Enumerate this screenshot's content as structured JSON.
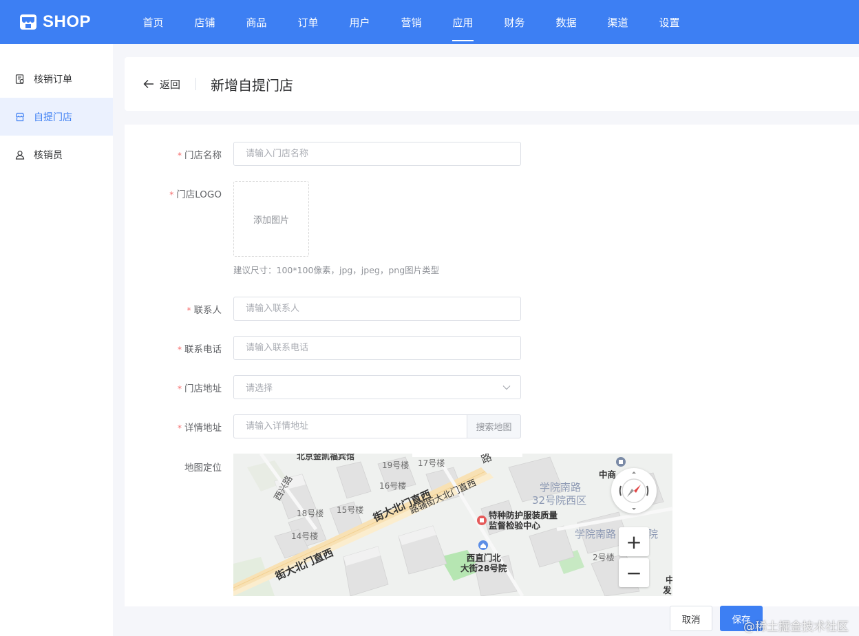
{
  "brand": {
    "name": "SHOP",
    "icon": "shop-icon"
  },
  "nav": {
    "items": [
      "首页",
      "店铺",
      "商品",
      "订单",
      "用户",
      "营销",
      "应用",
      "财务",
      "数据",
      "渠道",
      "设置"
    ],
    "active": "应用"
  },
  "sidebar": {
    "items": [
      {
        "label": "核销订单",
        "icon": "order-doc-icon"
      },
      {
        "label": "自提门店",
        "icon": "store-icon",
        "active": true
      },
      {
        "label": "核销员",
        "icon": "user-icon"
      }
    ]
  },
  "header": {
    "back_label": "返回",
    "title": "新增自提门店"
  },
  "form": {
    "store_name": {
      "label": "门店名称",
      "placeholder": "请输入门店名称"
    },
    "logo": {
      "label": "门店LOGO",
      "upload_label": "添加图片",
      "hint": "建议尺寸：100*100像素，jpg，jpeg，png图片类型"
    },
    "contact": {
      "label": "联系人",
      "placeholder": "请输入联系人"
    },
    "phone": {
      "label": "联系电话",
      "placeholder": "请输入联系电话"
    },
    "address": {
      "label": "门店地址",
      "placeholder": "请选择"
    },
    "detail_address": {
      "label": "详情地址",
      "placeholder": "请输入详情地址",
      "search_label": "搜索地图"
    },
    "map": {
      "label": "地图定位"
    }
  },
  "map_labels": {
    "hotel": "北京金凯福宾馆",
    "b19": "19号楼",
    "b17": "17号楼",
    "b16": "16号楼",
    "b18": "18号楼",
    "b15": "15号楼",
    "b14": "14号楼",
    "b2": "2号楼",
    "road_lu": "路",
    "road_xingxi": "西兴路",
    "road_main1": "街大北门直西",
    "road_main2": "路辅街大北门直西",
    "road_main3": "街大北门直西",
    "district1": "学院南路",
    "district2": "32号院西区",
    "district3": "学院南路",
    "district3b": "院",
    "poi1a": "特种防护服装质量",
    "poi1b": "监督检验中心",
    "poi2a": "西直门北",
    "poi2b": "大街28号院",
    "zhongshang": "中商",
    "edge1": "中",
    "edge2": "发",
    "zoom_in": "+",
    "zoom_out": "−"
  },
  "footer": {
    "cancel": "取消",
    "save": "保存"
  },
  "watermark": "@稀土掘金技术社区",
  "colors": {
    "primary": "#3d7ff3",
    "required": "#f56c6c"
  }
}
